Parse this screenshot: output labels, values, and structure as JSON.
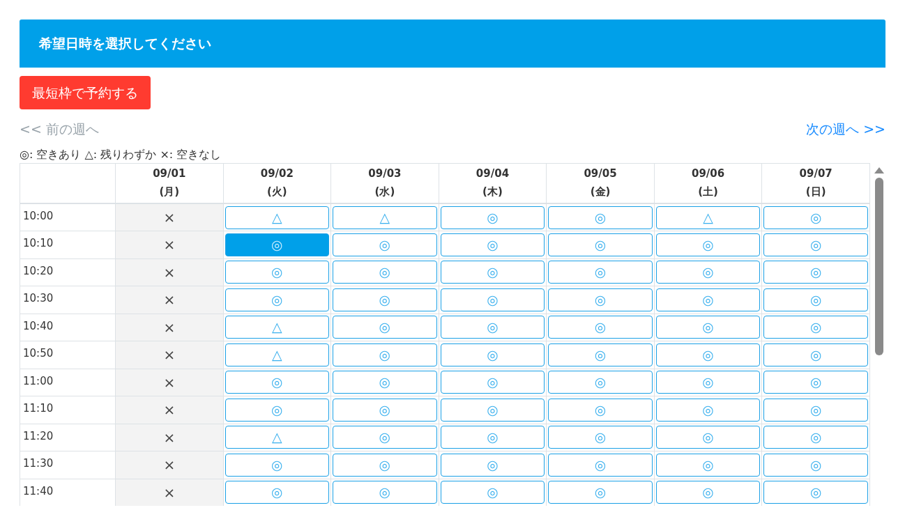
{
  "header": {
    "title": "希望日時を選択してください"
  },
  "earliest_button": {
    "label": "最短枠で予約する"
  },
  "week_nav": {
    "previous": {
      "label": "<< 前の週へ",
      "disabled": true
    },
    "next": {
      "label": "次の週へ >>",
      "disabled": false
    }
  },
  "legend": "◎: 空きあり △: 残りわずか ×: 空きなし",
  "table": {
    "columns": [
      {
        "date": "09/01",
        "weekday": "(月)"
      },
      {
        "date": "09/02",
        "weekday": "(火)"
      },
      {
        "date": "09/03",
        "weekday": "(水)"
      },
      {
        "date": "09/04",
        "weekday": "(木)"
      },
      {
        "date": "09/05",
        "weekday": "(金)"
      },
      {
        "date": "09/06",
        "weekday": "(土)"
      },
      {
        "date": "09/07",
        "weekday": "(日)"
      }
    ],
    "rows": [
      {
        "time": "10:00",
        "slots": [
          {
            "kind": "closed",
            "text": "×"
          },
          {
            "kind": "open",
            "text": "△",
            "selected": false
          },
          {
            "kind": "open",
            "text": "△",
            "selected": false
          },
          {
            "kind": "open",
            "text": "◎",
            "selected": false
          },
          {
            "kind": "open",
            "text": "◎",
            "selected": false
          },
          {
            "kind": "open",
            "text": "△",
            "selected": false
          },
          {
            "kind": "open",
            "text": "◎",
            "selected": false
          }
        ]
      },
      {
        "time": "10:10",
        "slots": [
          {
            "kind": "closed",
            "text": "×"
          },
          {
            "kind": "open",
            "text": "◎",
            "selected": true
          },
          {
            "kind": "open",
            "text": "◎",
            "selected": false
          },
          {
            "kind": "open",
            "text": "◎",
            "selected": false
          },
          {
            "kind": "open",
            "text": "◎",
            "selected": false
          },
          {
            "kind": "open",
            "text": "◎",
            "selected": false
          },
          {
            "kind": "open",
            "text": "◎",
            "selected": false
          }
        ]
      },
      {
        "time": "10:20",
        "slots": [
          {
            "kind": "closed",
            "text": "×"
          },
          {
            "kind": "open",
            "text": "◎",
            "selected": false
          },
          {
            "kind": "open",
            "text": "◎",
            "selected": false
          },
          {
            "kind": "open",
            "text": "◎",
            "selected": false
          },
          {
            "kind": "open",
            "text": "◎",
            "selected": false
          },
          {
            "kind": "open",
            "text": "◎",
            "selected": false
          },
          {
            "kind": "open",
            "text": "◎",
            "selected": false
          }
        ]
      },
      {
        "time": "10:30",
        "slots": [
          {
            "kind": "closed",
            "text": "×"
          },
          {
            "kind": "open",
            "text": "◎",
            "selected": false
          },
          {
            "kind": "open",
            "text": "◎",
            "selected": false
          },
          {
            "kind": "open",
            "text": "◎",
            "selected": false
          },
          {
            "kind": "open",
            "text": "◎",
            "selected": false
          },
          {
            "kind": "open",
            "text": "◎",
            "selected": false
          },
          {
            "kind": "open",
            "text": "◎",
            "selected": false
          }
        ]
      },
      {
        "time": "10:40",
        "slots": [
          {
            "kind": "closed",
            "text": "×"
          },
          {
            "kind": "open",
            "text": "△",
            "selected": false
          },
          {
            "kind": "open",
            "text": "◎",
            "selected": false
          },
          {
            "kind": "open",
            "text": "◎",
            "selected": false
          },
          {
            "kind": "open",
            "text": "◎",
            "selected": false
          },
          {
            "kind": "open",
            "text": "◎",
            "selected": false
          },
          {
            "kind": "open",
            "text": "◎",
            "selected": false
          }
        ]
      },
      {
        "time": "10:50",
        "slots": [
          {
            "kind": "closed",
            "text": "×"
          },
          {
            "kind": "open",
            "text": "△",
            "selected": false
          },
          {
            "kind": "open",
            "text": "◎",
            "selected": false
          },
          {
            "kind": "open",
            "text": "◎",
            "selected": false
          },
          {
            "kind": "open",
            "text": "◎",
            "selected": false
          },
          {
            "kind": "open",
            "text": "◎",
            "selected": false
          },
          {
            "kind": "open",
            "text": "◎",
            "selected": false
          }
        ]
      },
      {
        "time": "11:00",
        "slots": [
          {
            "kind": "closed",
            "text": "×"
          },
          {
            "kind": "open",
            "text": "◎",
            "selected": false
          },
          {
            "kind": "open",
            "text": "◎",
            "selected": false
          },
          {
            "kind": "open",
            "text": "◎",
            "selected": false
          },
          {
            "kind": "open",
            "text": "◎",
            "selected": false
          },
          {
            "kind": "open",
            "text": "◎",
            "selected": false
          },
          {
            "kind": "open",
            "text": "◎",
            "selected": false
          }
        ]
      },
      {
        "time": "11:10",
        "slots": [
          {
            "kind": "closed",
            "text": "×"
          },
          {
            "kind": "open",
            "text": "◎",
            "selected": false
          },
          {
            "kind": "open",
            "text": "◎",
            "selected": false
          },
          {
            "kind": "open",
            "text": "◎",
            "selected": false
          },
          {
            "kind": "open",
            "text": "◎",
            "selected": false
          },
          {
            "kind": "open",
            "text": "◎",
            "selected": false
          },
          {
            "kind": "open",
            "text": "◎",
            "selected": false
          }
        ]
      },
      {
        "time": "11:20",
        "slots": [
          {
            "kind": "closed",
            "text": "×"
          },
          {
            "kind": "open",
            "text": "△",
            "selected": false
          },
          {
            "kind": "open",
            "text": "◎",
            "selected": false
          },
          {
            "kind": "open",
            "text": "◎",
            "selected": false
          },
          {
            "kind": "open",
            "text": "◎",
            "selected": false
          },
          {
            "kind": "open",
            "text": "◎",
            "selected": false
          },
          {
            "kind": "open",
            "text": "◎",
            "selected": false
          }
        ]
      },
      {
        "time": "11:30",
        "slots": [
          {
            "kind": "closed",
            "text": "×"
          },
          {
            "kind": "open",
            "text": "◎",
            "selected": false
          },
          {
            "kind": "open",
            "text": "◎",
            "selected": false
          },
          {
            "kind": "open",
            "text": "◎",
            "selected": false
          },
          {
            "kind": "open",
            "text": "◎",
            "selected": false
          },
          {
            "kind": "open",
            "text": "◎",
            "selected": false
          },
          {
            "kind": "open",
            "text": "◎",
            "selected": false
          }
        ]
      },
      {
        "time": "11:40",
        "slots": [
          {
            "kind": "closed",
            "text": "×"
          },
          {
            "kind": "open",
            "text": "◎",
            "selected": false
          },
          {
            "kind": "open",
            "text": "◎",
            "selected": false
          },
          {
            "kind": "open",
            "text": "◎",
            "selected": false
          },
          {
            "kind": "open",
            "text": "◎",
            "selected": false
          },
          {
            "kind": "open",
            "text": "◎",
            "selected": false
          },
          {
            "kind": "open",
            "text": "◎",
            "selected": false
          }
        ]
      }
    ]
  }
}
